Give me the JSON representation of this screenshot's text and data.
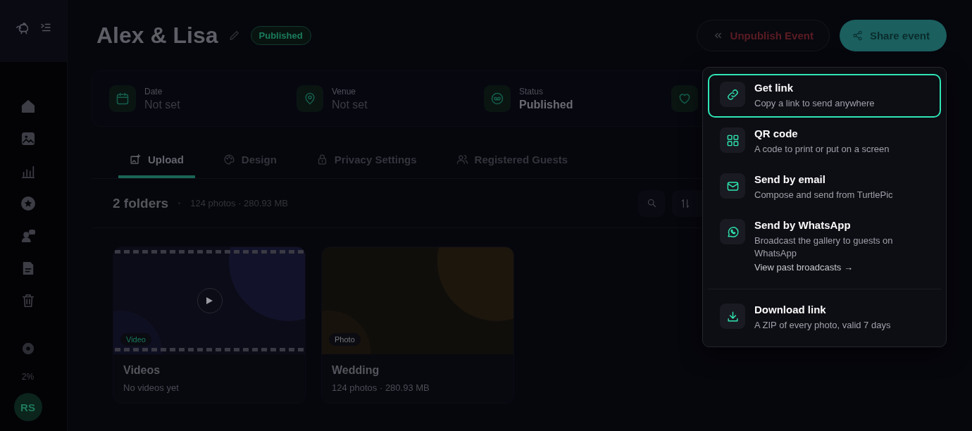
{
  "sidebar": {
    "usage": "2%",
    "avatar": "RS"
  },
  "header": {
    "title": "Alex & Lisa",
    "badge": "Published",
    "actions": [
      {
        "label": "Unpublish Event",
        "kind": "danger"
      },
      {
        "label": "Share event",
        "kind": "primary"
      }
    ]
  },
  "info": [
    {
      "label": "Date",
      "value": "Not set",
      "muted": true
    },
    {
      "label": "Venue",
      "value": "Not set",
      "muted": true
    },
    {
      "label": "Status",
      "value": "Published",
      "muted": false
    }
  ],
  "tabs": [
    {
      "label": "Upload",
      "selected": true
    },
    {
      "label": "Design",
      "selected": false
    },
    {
      "label": "Privacy Settings",
      "selected": false
    },
    {
      "label": "Registered Guests",
      "selected": false
    }
  ],
  "toolbar": {
    "count": "2 folders",
    "summary": "124 photos · 280.93 MB"
  },
  "folders": [
    {
      "kind": "video",
      "tag": "Video",
      "title": "Videos",
      "subtitle": "No videos yet"
    },
    {
      "kind": "photo",
      "tag": "Photo",
      "title": "Wedding",
      "subtitle": "124 photos · 280.93 MB"
    }
  ],
  "share_menu": {
    "items": [
      {
        "title": "Get link",
        "description": "Copy a link to send anywhere",
        "selected": true
      },
      {
        "title": "QR code",
        "description": "A code to print or put on a screen",
        "selected": false
      },
      {
        "title": "Send by email",
        "description": "Compose and send from TurtlePic",
        "selected": false
      },
      {
        "title": "Send by WhatsApp",
        "description": "Broadcast the gallery to guests on WhatsApp",
        "link": "View past broadcasts →",
        "selected": false
      }
    ],
    "footer_items": [
      {
        "title": "Download link",
        "description": "A ZIP of every photo, valid 7 days",
        "selected": false
      }
    ]
  }
}
